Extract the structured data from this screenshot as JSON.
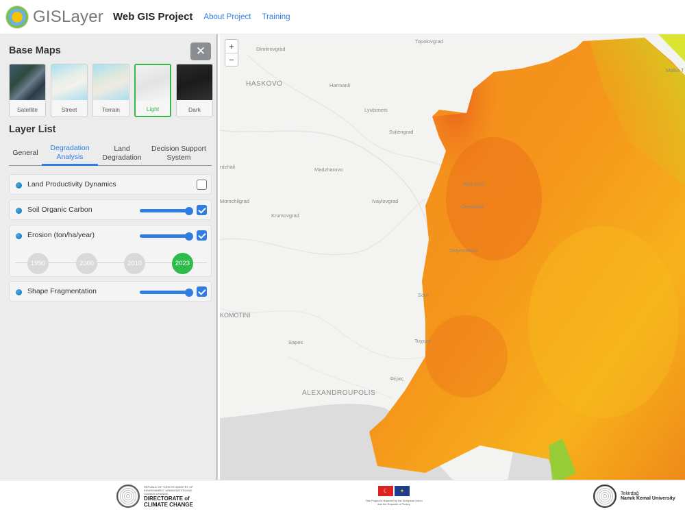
{
  "header": {
    "logo_text": "GISLayer",
    "app_title": "Web GIS Project",
    "nav": [
      "About Project",
      "Training"
    ]
  },
  "sidebar": {
    "base_maps_title": "Base Maps",
    "close_symbol": "✕",
    "base_maps": [
      {
        "label": "Satellite",
        "active": false
      },
      {
        "label": "Street",
        "active": false
      },
      {
        "label": "Terrain",
        "active": false
      },
      {
        "label": "Light",
        "active": true
      },
      {
        "label": "Dark",
        "active": false
      }
    ],
    "layer_list_title": "Layer List",
    "tabs": [
      {
        "label": "General",
        "active": false
      },
      {
        "label": "Degradation Analysis",
        "active": true
      },
      {
        "label": "Land Degradation",
        "active": false
      },
      {
        "label": "Decision Support System",
        "active": false
      }
    ],
    "layers": [
      {
        "name": "Land Productivity Dynamics",
        "checked": false,
        "has_slider": false
      },
      {
        "name": "Soil Organic Carbon",
        "checked": true,
        "has_slider": true,
        "opacity": 1.0
      },
      {
        "name": "Erosion (ton/ha/year)",
        "checked": true,
        "has_slider": true,
        "opacity": 1.0,
        "years": [
          "1990",
          "2000",
          "2010",
          "2023"
        ],
        "active_year": "2023"
      },
      {
        "name": "Shape Fragmentation",
        "checked": true,
        "has_slider": true,
        "opacity": 1.0
      }
    ]
  },
  "map": {
    "zoom_in": "+",
    "zoom_out": "−",
    "places": {
      "dimitrovgrad": "Dimitrovgrad",
      "topolovgrad": "Topolovgrad",
      "haskovo": "HASKOVO",
      "harmanli": "Harmanli",
      "malko": "Malko T",
      "lyubimets": "Lyubimets",
      "svilengrad": "Svilengrad",
      "kardzhali": "rdzhali",
      "madzharovo": "Madzharovo",
      "neavyssa": "Nea Vyss",
      "momchilgrad": "Momchilgrad",
      "ivaylovgrad": "Ivaylovgrad",
      "orestiada": "Orestiada",
      "krumovgrad": "Krumovgrad",
      "didymoticho": "Didymoticho",
      "soufli": "Soul",
      "komotini": "KOMOTINI",
      "sapes": "Sapes",
      "tychero": "Τυχερό",
      "feres": "Φέρες",
      "alexandroupolis": "ALEXANDROUPOLIS"
    },
    "colors": {
      "high": "#e8541a",
      "mid": "#f6a21b",
      "low": "#d9e21d",
      "green": "#8ccf3a",
      "sea": "#dcdcdc"
    }
  },
  "footer": {
    "dcc_small": "REPUBLIC OF TÜRKİYE MINISTRY OF ENVIRONMENT, URBANISATION AND CLIMATE CHANGE",
    "dcc_line1": "DIRECTORATE of",
    "dcc_line2": "CLIMATE CHANGE",
    "eu_line1": "This Project is financed by the European Union",
    "eu_line2": "and the Republic of Turkey",
    "tnku_line1": "Tekirdağ",
    "tnku_line2": "Namık Kemal University"
  }
}
